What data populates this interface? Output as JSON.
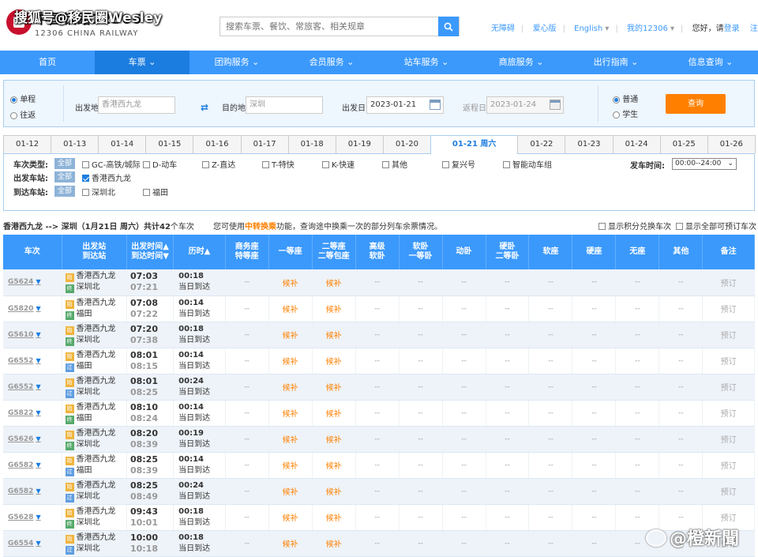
{
  "watermark_top": "搜狐号@移民圈Wesley",
  "watermark_bottom": "@橙新聞",
  "header": {
    "logo_cn": "中国铁路12306",
    "logo_en": "12306 CHINA RAILWAY",
    "search_placeholder": "搜索车票、餐饮、常旅客、相关规章",
    "links": [
      "无障碍",
      "爱心版",
      "English",
      "我的12306"
    ],
    "greeting": "您好，请",
    "login": "登录",
    "register": "注册"
  },
  "nav": [
    "首页",
    "车票",
    "团购服务",
    "会员服务",
    "站车服务",
    "商旅服务",
    "出行指南",
    "信息查询"
  ],
  "query": {
    "trip_single": "单程",
    "trip_round": "往返",
    "from_label": "出发地",
    "from_value": "香港西九龙",
    "to_label": "目的地",
    "to_value": "深圳",
    "depart_label": "出发日",
    "depart_value": "2023-01-21",
    "return_label": "返程日",
    "return_value": "2023-01-24",
    "type_normal": "普通",
    "type_student": "学生",
    "search_button": "查询"
  },
  "dates": [
    "01-12",
    "01-13",
    "01-14",
    "01-15",
    "01-16",
    "01-17",
    "01-18",
    "01-19",
    "01-20",
    "01-21 周六",
    "01-22",
    "01-23",
    "01-24",
    "01-25",
    "01-26"
  ],
  "filters": {
    "train_type_label": "车次类型:",
    "all": "全部",
    "train_types": [
      "GC-高铁/城际",
      "D-动车",
      "Z-直达",
      "T-特快",
      "K-快速",
      "其他",
      "复兴号",
      "智能动车组"
    ],
    "depart_station_label": "出发车站:",
    "depart_stations": [
      "香港西九龙"
    ],
    "arrive_station_label": "到达车站:",
    "arrive_stations": [
      "深圳北",
      "福田"
    ],
    "depart_time_label": "发车时间:",
    "depart_time_value": "00:00--24:00"
  },
  "summary": {
    "route": "香港西九龙 --> 深圳（1月21日 周六）共计",
    "count": "42",
    "count_suffix": "个车次",
    "notice_pre": "您可使用",
    "notice_hl": "中转换乘",
    "notice_post": "功能，查询途中换乘一次的部分列车余票情况。",
    "opt1": "显示积分兑换车次",
    "opt2": "显示全部可预订车次"
  },
  "table": {
    "headers": [
      "车次",
      "出发站\n到达站",
      "出发时间▲\n到达时间▼",
      "历时▲",
      "商务座\n特等座",
      "一等座",
      "二等座\n二等包座",
      "高级\n软卧",
      "软卧\n一等卧",
      "动卧",
      "硬卧\n二等卧",
      "软座",
      "硬座",
      "无座",
      "其他",
      "备注"
    ],
    "rows": [
      {
        "no": "G5624",
        "from": "香港西九龙",
        "to": "深圳北",
        "to_tag": "终",
        "dep": "07:03",
        "arr": "07:21",
        "dur": "00:18",
        "day": "当日到达"
      },
      {
        "no": "G5820",
        "from": "香港西九龙",
        "to": "福田",
        "to_tag": "终",
        "dep": "07:08",
        "arr": "07:22",
        "dur": "00:14",
        "day": "当日到达"
      },
      {
        "no": "G5610",
        "from": "香港西九龙",
        "to": "深圳北",
        "to_tag": "终",
        "dep": "07:20",
        "arr": "07:38",
        "dur": "00:18",
        "day": "当日到达"
      },
      {
        "no": "G6552",
        "from": "香港西九龙",
        "to": "福田",
        "to_tag": "过",
        "dep": "08:01",
        "arr": "08:15",
        "dur": "00:14",
        "day": "当日到达"
      },
      {
        "no": "G6552",
        "from": "香港西九龙",
        "to": "深圳北",
        "to_tag": "过",
        "dep": "08:01",
        "arr": "08:25",
        "dur": "00:24",
        "day": "当日到达"
      },
      {
        "no": "G5822",
        "from": "香港西九龙",
        "to": "福田",
        "to_tag": "终",
        "dep": "08:10",
        "arr": "08:24",
        "dur": "00:14",
        "day": "当日到达"
      },
      {
        "no": "G5626",
        "from": "香港西九龙",
        "to": "深圳北",
        "to_tag": "终",
        "dep": "08:20",
        "arr": "08:39",
        "dur": "00:19",
        "day": "当日到达"
      },
      {
        "no": "G6582",
        "from": "香港西九龙",
        "to": "福田",
        "to_tag": "过",
        "dep": "08:25",
        "arr": "08:39",
        "dur": "00:14",
        "day": "当日到达"
      },
      {
        "no": "G6582",
        "from": "香港西九龙",
        "to": "深圳北",
        "to_tag": "过",
        "dep": "08:25",
        "arr": "08:49",
        "dur": "00:24",
        "day": "当日到达"
      },
      {
        "no": "G5628",
        "from": "香港西九龙",
        "to": "深圳北",
        "to_tag": "终",
        "dep": "09:43",
        "arr": "10:01",
        "dur": "00:18",
        "day": "当日到达"
      },
      {
        "no": "G6554",
        "from": "香港西九龙",
        "to": "深圳北",
        "to_tag": "过",
        "dep": "10:00",
        "arr": "10:18",
        "dur": "00:18",
        "day": "当日到达"
      }
    ],
    "dash": "--",
    "waitlist": "候补",
    "book": "预订",
    "start_tag": "始"
  }
}
